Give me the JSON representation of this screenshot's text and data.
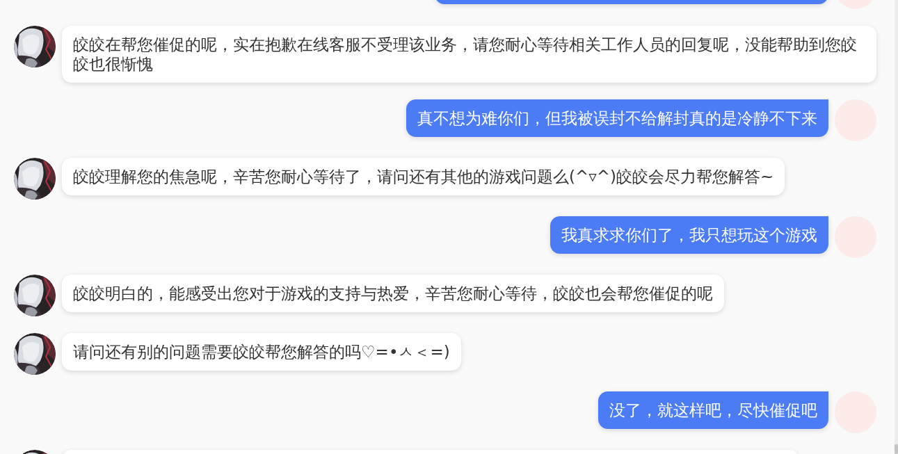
{
  "messages": [
    {
      "kind": "user"
    },
    {
      "kind": "bot",
      "text": "皎皎在帮您催促的呢，实在抱歉在线客服不受理该业务，请您耐心等待相关工作人员的回复呢，没能帮助到您皎皎也很惭愧"
    },
    {
      "kind": "user",
      "text": "真不想为难你们，但我被误封不给解封真的是冷静不下来"
    },
    {
      "kind": "bot",
      "text": "皎皎理解您的焦急呢，辛苦您耐心等待了，请问还有其他的游戏问题么(^▿^)皎皎会尽力帮您解答~"
    },
    {
      "kind": "user",
      "text": "我真求求你们了，我只想玩这个游戏"
    },
    {
      "kind": "bot",
      "text": "皎皎明白的，能感受出您对于游戏的支持与热爱，辛苦您耐心等待，皎皎也会帮您催促的呢"
    },
    {
      "kind": "bot",
      "text": "请问还有别的问题需要皎皎帮您解答的吗♡=•ㅅ＜=)"
    },
    {
      "kind": "user",
      "text": "没了，就这样吧，尽快催促吧"
    },
    {
      "kind": "bot"
    }
  ]
}
